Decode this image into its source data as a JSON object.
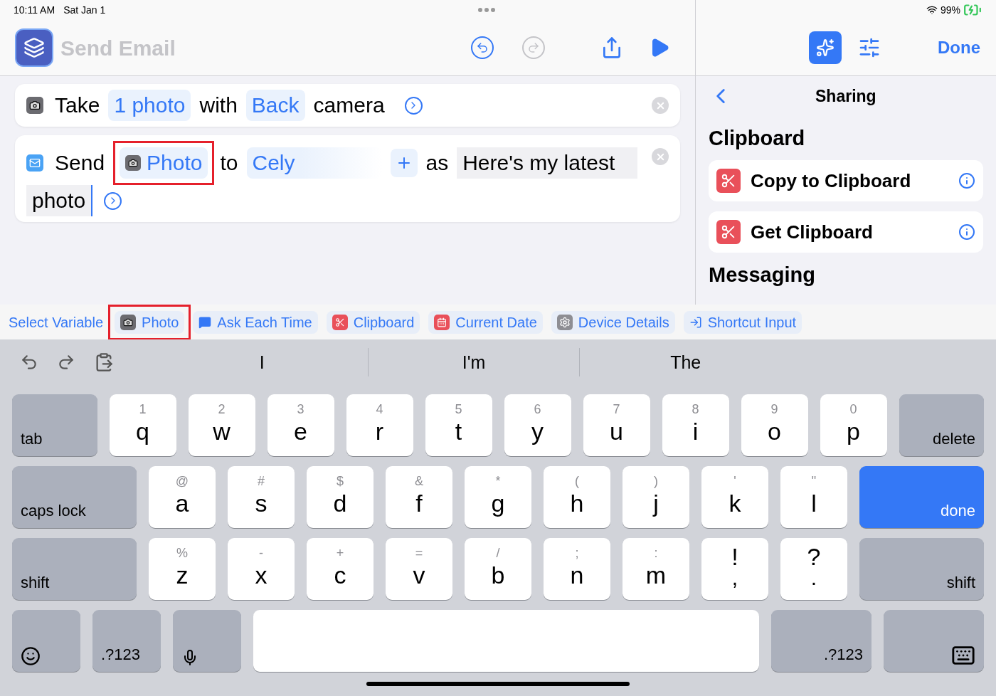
{
  "status_bar": {
    "time": "10:11 AM",
    "date": "Sat Jan 1",
    "battery": "99%"
  },
  "editor": {
    "title": "Send Email",
    "undo": {
      "disabled": false
    },
    "redo": {
      "disabled": true
    }
  },
  "actions": [
    {
      "kind": "camera",
      "parts": [
        {
          "kind": "text",
          "text": "Take"
        },
        {
          "kind": "token",
          "text": "1 photo"
        },
        {
          "kind": "text",
          "text": "with"
        },
        {
          "kind": "token",
          "text": "Back"
        },
        {
          "kind": "text",
          "text": "camera"
        }
      ]
    },
    {
      "kind": "mail",
      "parts": [
        {
          "kind": "text",
          "text": "Send"
        },
        {
          "kind": "variable",
          "text": "Photo",
          "highlighted": true
        },
        {
          "kind": "text",
          "text": "to"
        },
        {
          "kind": "recipient",
          "text": "Cely"
        },
        {
          "kind": "add"
        },
        {
          "kind": "text",
          "text": "as"
        },
        {
          "kind": "field",
          "lines": [
            "Here's my latest",
            "photo"
          ]
        }
      ]
    }
  ],
  "variable_bar": {
    "label": "Select Variable",
    "chips": [
      {
        "kind": "camera",
        "label": "Photo",
        "highlighted": true
      },
      {
        "kind": "message",
        "label": "Ask Each Time",
        "highlighted": false
      },
      {
        "kind": "clipboard",
        "label": "Clipboard",
        "highlighted": false
      },
      {
        "kind": "date",
        "label": "Current Date",
        "highlighted": false
      },
      {
        "kind": "device",
        "label": "Device Details",
        "highlighted": false
      },
      {
        "kind": "input",
        "label": "Shortcut Input",
        "highlighted": false
      }
    ]
  },
  "sidebar": {
    "tabs": [
      {
        "kind": "gallery",
        "selected": true
      },
      {
        "kind": "settings",
        "selected": false
      }
    ],
    "done": "Done",
    "title": "Sharing",
    "sections": [
      {
        "title": "Clipboard",
        "items": [
          "Copy to Clipboard",
          "Get Clipboard"
        ]
      },
      {
        "title": "Messaging"
      }
    ]
  },
  "suggestions": [
    "I",
    "I'm",
    "The"
  ],
  "keyboard": [
    [
      {
        "kind": "function",
        "label": "tab"
      },
      {
        "kind": "letter",
        "hint": "1",
        "label": "q"
      },
      {
        "kind": "letter",
        "hint": "2",
        "label": "w"
      },
      {
        "kind": "letter",
        "hint": "3",
        "label": "e"
      },
      {
        "kind": "letter",
        "hint": "4",
        "label": "r"
      },
      {
        "kind": "letter",
        "hint": "5",
        "label": "t"
      },
      {
        "kind": "letter",
        "hint": "6",
        "label": "y"
      },
      {
        "kind": "letter",
        "hint": "7",
        "label": "u"
      },
      {
        "kind": "letter",
        "hint": "8",
        "label": "i"
      },
      {
        "kind": "letter",
        "hint": "9",
        "label": "o"
      },
      {
        "kind": "letter",
        "hint": "0",
        "label": "p"
      },
      {
        "kind": "function",
        "label": "delete"
      }
    ],
    [
      {
        "kind": "function",
        "label": "caps lock"
      },
      {
        "kind": "letter",
        "hint": "@",
        "label": "a"
      },
      {
        "kind": "letter",
        "hint": "#",
        "label": "s"
      },
      {
        "kind": "letter",
        "hint": "$",
        "label": "d"
      },
      {
        "kind": "letter",
        "hint": "&",
        "label": "f"
      },
      {
        "kind": "letter",
        "hint": "*",
        "label": "g"
      },
      {
        "kind": "letter",
        "hint": "(",
        "label": "h"
      },
      {
        "kind": "letter",
        "hint": ")",
        "label": "j"
      },
      {
        "kind": "letter",
        "hint": "'",
        "label": "k"
      },
      {
        "kind": "letter",
        "hint": "\"",
        "label": "l"
      },
      {
        "kind": "action",
        "label": "done"
      }
    ],
    [
      {
        "kind": "function",
        "label": "shift"
      },
      {
        "kind": "letter",
        "hint": "%",
        "label": "z"
      },
      {
        "kind": "letter",
        "hint": "-",
        "label": "x"
      },
      {
        "kind": "letter",
        "hint": "+",
        "label": "c"
      },
      {
        "kind": "letter",
        "hint": "=",
        "label": "v"
      },
      {
        "kind": "letter",
        "hint": "/",
        "label": "b"
      },
      {
        "kind": "letter",
        "hint": ";",
        "label": "n"
      },
      {
        "kind": "letter",
        "hint": ":",
        "label": "m"
      },
      {
        "kind": "punct",
        "label": "!",
        "hint": ","
      },
      {
        "kind": "punct",
        "label": "?",
        "hint": "."
      },
      {
        "kind": "function",
        "label": "shift"
      }
    ],
    [
      {
        "kind": "emoji"
      },
      {
        "kind": "function",
        "label": ".?123"
      },
      {
        "kind": "dictation"
      },
      {
        "kind": "space"
      },
      {
        "kind": "function",
        "label": ".?123"
      },
      {
        "kind": "hide"
      }
    ]
  ]
}
